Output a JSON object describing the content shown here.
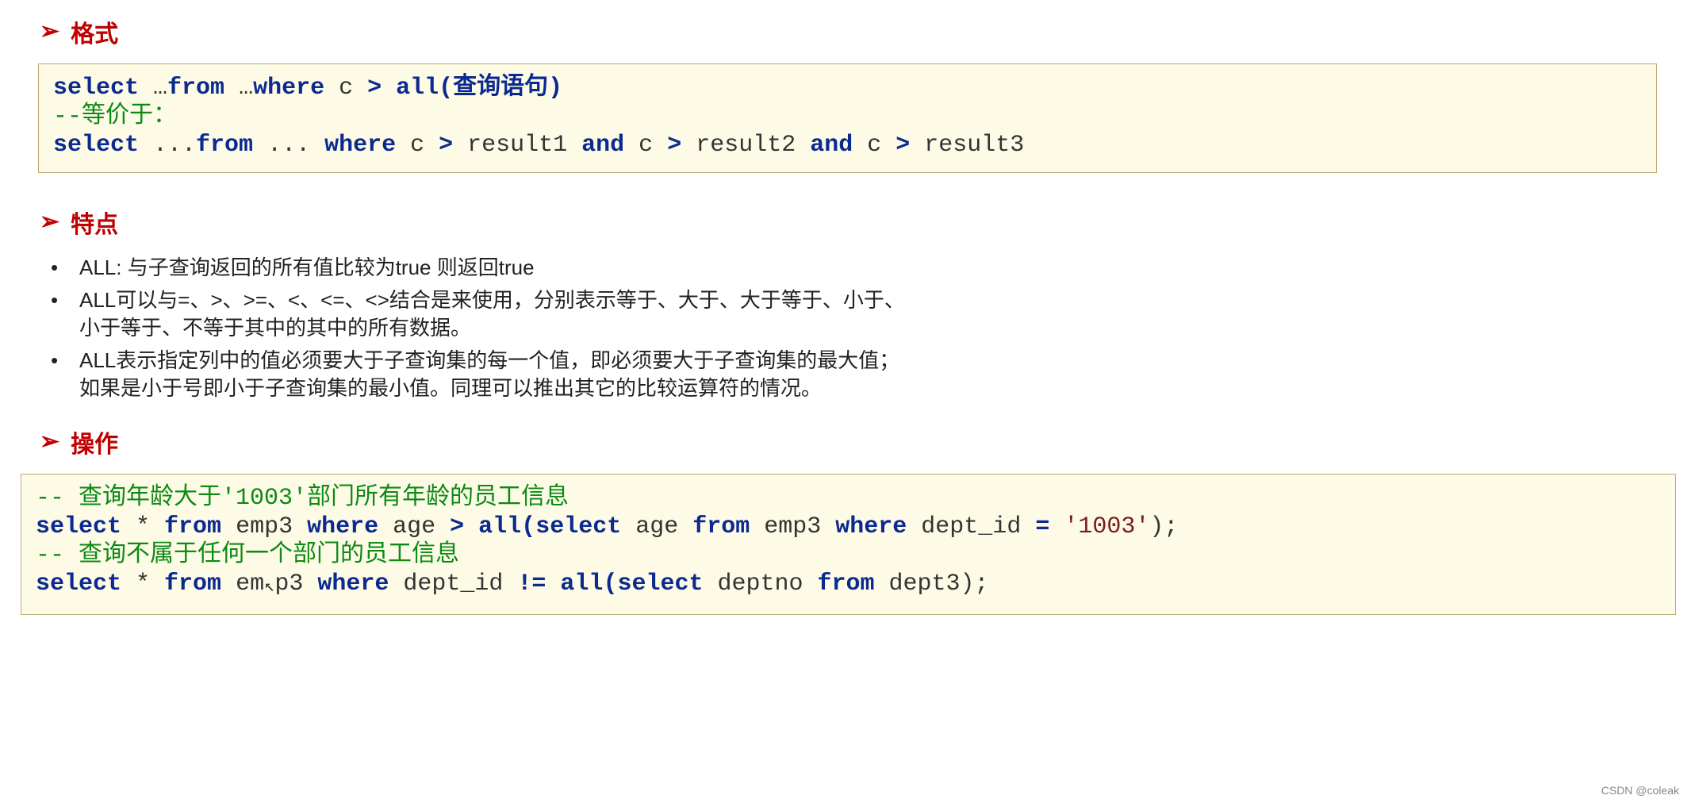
{
  "section1": {
    "title": "格式"
  },
  "code1": {
    "l1": {
      "a": "select",
      "b": " …",
      "c": "from",
      "d": " …",
      "e": "where",
      "f": " c ",
      "g": ">",
      "h": " ",
      "i": "all",
      "j": "(查询语句)"
    },
    "l2": "--等价于：",
    "l3": {
      "a": "select",
      "b": " ...",
      "c": "from",
      "d": " ... ",
      "e": "where",
      "f": " c ",
      "g": ">",
      "h": " result1 ",
      "i": "and",
      "j": " c ",
      "k": ">",
      "l": " result2 ",
      "m": "and",
      "n": " c ",
      "o": ">",
      "p": " result3"
    }
  },
  "section2": {
    "title": "特点"
  },
  "features": [
    "ALL: 与子查询返回的所有值比较为true 则返回true",
    "ALL可以与=、>、>=、<、<=、<>结合是来使用，分别表示等于、大于、大于等于、小于、小于等于、不等于其中的其中的所有数据。",
    "ALL表示指定列中的值必须要大于子查询集的每一个值，即必须要大于子查询集的最大值；如果是小于号即小于子查询集的最小值。同理可以推出其它的比较运算符的情况。"
  ],
  "section3": {
    "title": "操作"
  },
  "code2": {
    "c1": "-- 查询年龄大于'1003'部门所有年龄的员工信息",
    "l1": {
      "a": "select",
      "b": " * ",
      "c": "from",
      "d": " emp3 ",
      "e": "where",
      "f": " age ",
      "g": ">",
      "h": " ",
      "i": "all",
      "j": "(",
      "k": "select",
      "l": " age ",
      "m": "from",
      "n": " emp3 ",
      "o": "where",
      "p": " dept_id ",
      "q": "=",
      "r": " ",
      "s": "'1003'",
      "t": ");"
    },
    "c2a": "-- 查询不属于任何一",
    "c2b": "个部门的员工信息",
    "l2": {
      "a": "select",
      "b": " * ",
      "c": "from",
      "d": " em",
      "cur": "↖",
      "d2": "p3 ",
      "e": "where",
      "f": " dept_id ",
      "g": "!=",
      "h": " ",
      "i": "all",
      "j": "(",
      "k": "select",
      "l": " deptno ",
      "m": "from",
      "n": " dept3);"
    }
  },
  "watermark": "CSDN @coleak"
}
